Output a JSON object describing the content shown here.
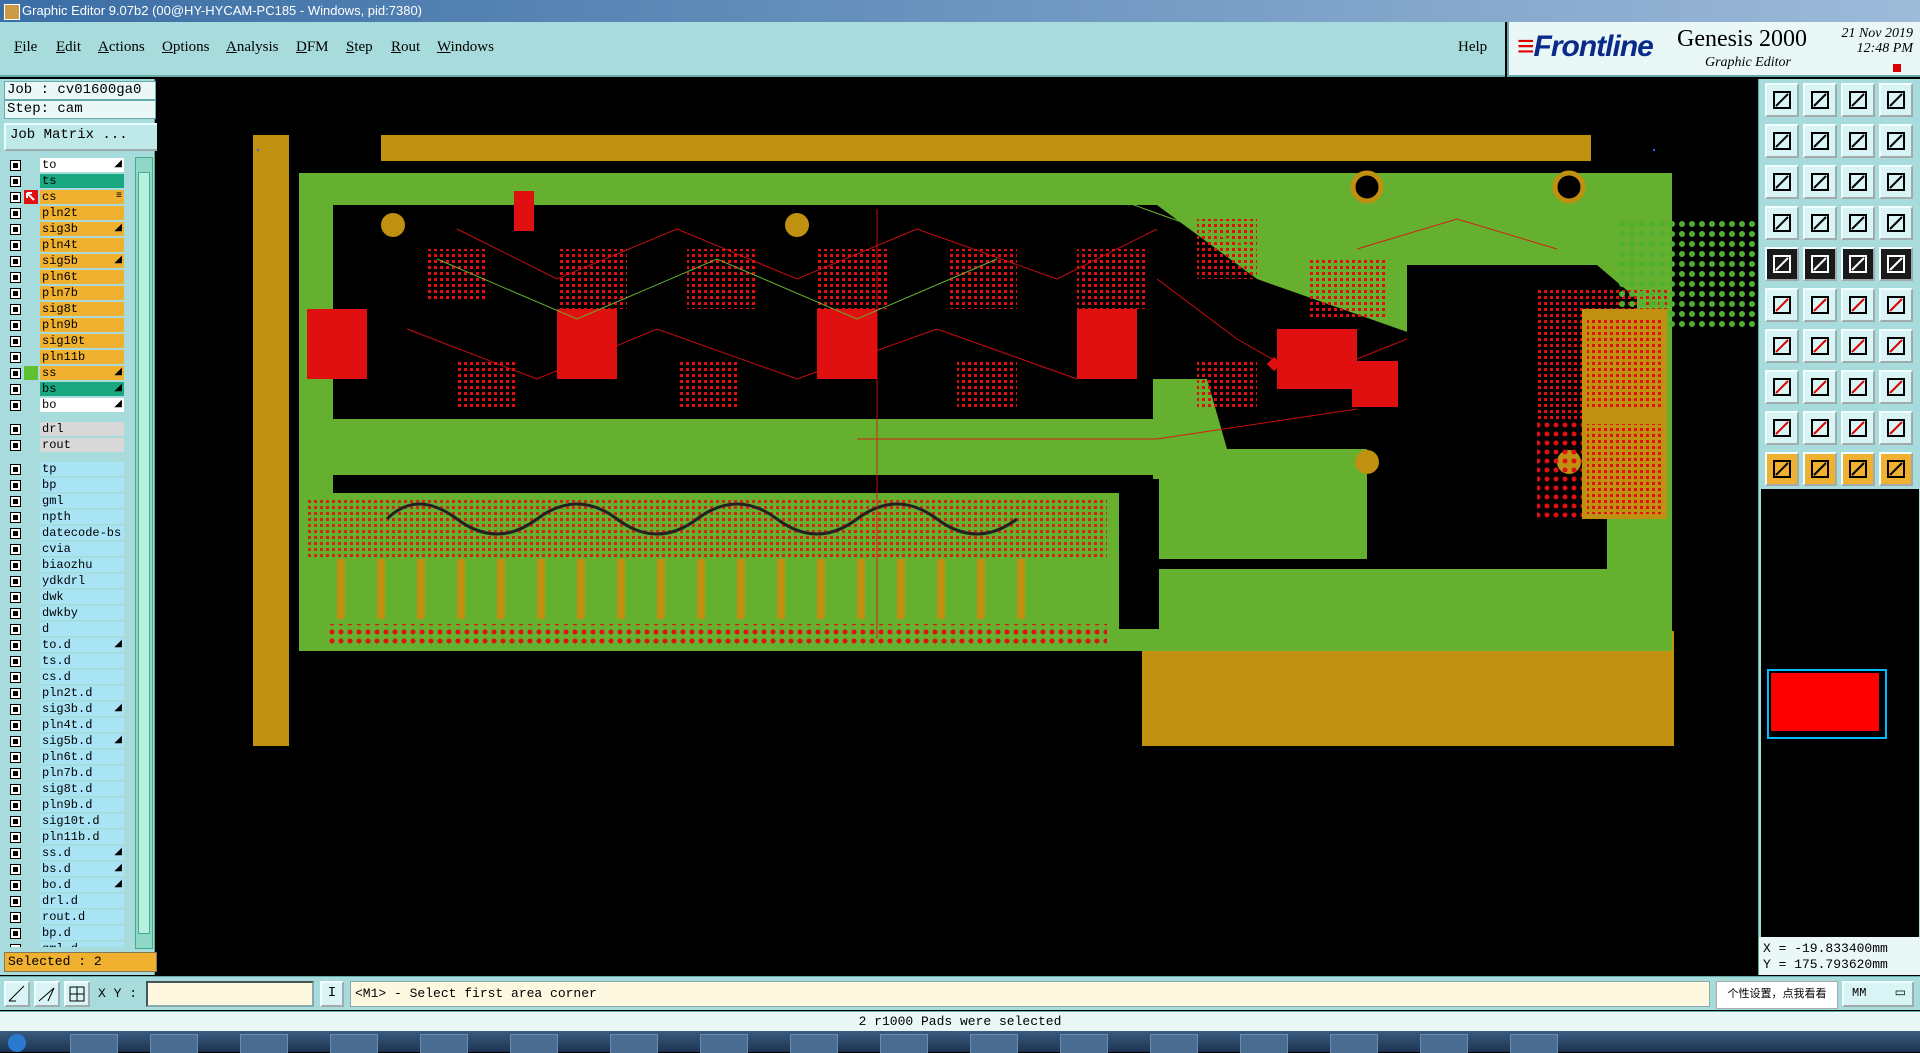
{
  "window": {
    "title": "Graphic Editor 9.07b2 (00@HY-HYCAM-PC185 - Windows, pid:7380)"
  },
  "menu": {
    "items": [
      "File",
      "Edit",
      "Actions",
      "Options",
      "Analysis",
      "DFM",
      "Step",
      "Rout",
      "Windows"
    ],
    "help": "Help"
  },
  "brand": {
    "logo": "Frontline",
    "product": "Genesis 2000",
    "subtitle": "Graphic Editor",
    "date": "21 Nov 2019",
    "time": "12:48 PM"
  },
  "job": {
    "job_line": "Job : cv01600ga0",
    "step_line": "Step: cam",
    "matrix_button": "Job Matrix ..."
  },
  "layers_board": [
    {
      "name": "to",
      "color": "#ffffff",
      "arrow": true
    },
    {
      "name": "ts",
      "color": "#1aa880",
      "arrow": false
    },
    {
      "name": "cs",
      "color": "#f0b030",
      "arrow": false,
      "active": true
    },
    {
      "name": "pln2t",
      "color": "#f0b030",
      "arrow": false
    },
    {
      "name": "sig3b",
      "color": "#f0b030",
      "arrow": true
    },
    {
      "name": "pln4t",
      "color": "#f0b030",
      "arrow": false
    },
    {
      "name": "sig5b",
      "color": "#f0b030",
      "arrow": true
    },
    {
      "name": "pln6t",
      "color": "#f0b030",
      "arrow": false
    },
    {
      "name": "pln7b",
      "color": "#f0b030",
      "arrow": false
    },
    {
      "name": "sig8t",
      "color": "#f0b030",
      "arrow": false
    },
    {
      "name": "pln9b",
      "color": "#f0b030",
      "arrow": false
    },
    {
      "name": "sig10t",
      "color": "#f0b030",
      "arrow": false
    },
    {
      "name": "pln11b",
      "color": "#f0b030",
      "arrow": false
    },
    {
      "name": "ss",
      "color": "#f0b030",
      "arrow": true
    },
    {
      "name": "bs",
      "color": "#1aa880",
      "arrow": true
    },
    {
      "name": "bo",
      "color": "#ffffff",
      "arrow": true
    }
  ],
  "layers_drill": [
    {
      "name": "drl",
      "color": "#d8d8d8",
      "arrow": false
    },
    {
      "name": "rout",
      "color": "#d8d8d8",
      "arrow": false
    }
  ],
  "layers_misc": [
    {
      "name": "tp",
      "arrow": false
    },
    {
      "name": "bp",
      "arrow": false
    },
    {
      "name": "gml",
      "arrow": false
    },
    {
      "name": "npth",
      "arrow": false
    },
    {
      "name": "datecode-bs",
      "arrow": false
    },
    {
      "name": "cvia",
      "arrow": false
    },
    {
      "name": "biaozhu",
      "arrow": false
    },
    {
      "name": "ydkdrl",
      "arrow": false
    },
    {
      "name": "dwk",
      "arrow": false
    },
    {
      "name": "dwkby",
      "arrow": false
    },
    {
      "name": "d",
      "arrow": false
    },
    {
      "name": "to.d",
      "arrow": true
    },
    {
      "name": "ts.d",
      "arrow": false
    },
    {
      "name": "cs.d",
      "arrow": false
    },
    {
      "name": "pln2t.d",
      "arrow": false
    },
    {
      "name": "sig3b.d",
      "arrow": true
    },
    {
      "name": "pln4t.d",
      "arrow": false
    },
    {
      "name": "sig5b.d",
      "arrow": true
    },
    {
      "name": "pln6t.d",
      "arrow": false
    },
    {
      "name": "pln7b.d",
      "arrow": false
    },
    {
      "name": "sig8t.d",
      "arrow": false
    },
    {
      "name": "pln9b.d",
      "arrow": false
    },
    {
      "name": "sig10t.d",
      "arrow": false
    },
    {
      "name": "pln11b.d",
      "arrow": false
    },
    {
      "name": "ss.d",
      "arrow": true
    },
    {
      "name": "bs.d",
      "arrow": true
    },
    {
      "name": "bo.d",
      "arrow": true
    },
    {
      "name": "drl.d",
      "arrow": false
    },
    {
      "name": "rout.d",
      "arrow": false
    },
    {
      "name": "bp.d",
      "arrow": false
    },
    {
      "name": "gml.d",
      "arrow": false
    }
  ],
  "selected": "Selected : 2",
  "coords": {
    "x": "X = -19.833400mm",
    "y": "Y = 175.793620mm"
  },
  "command": {
    "xy_label": "X Y :",
    "xy_value": "",
    "i_button": "I",
    "prompt": "<M1> - Select first area corner",
    "units": "MM",
    "tooltip": "个性设置，点我看看"
  },
  "status": "2 r1000 Pads were selected",
  "colors": {
    "ui_bg": "#a8dcdc",
    "board_green": "#66b030",
    "copper": "#c09010",
    "pads_red": "#e01010"
  }
}
